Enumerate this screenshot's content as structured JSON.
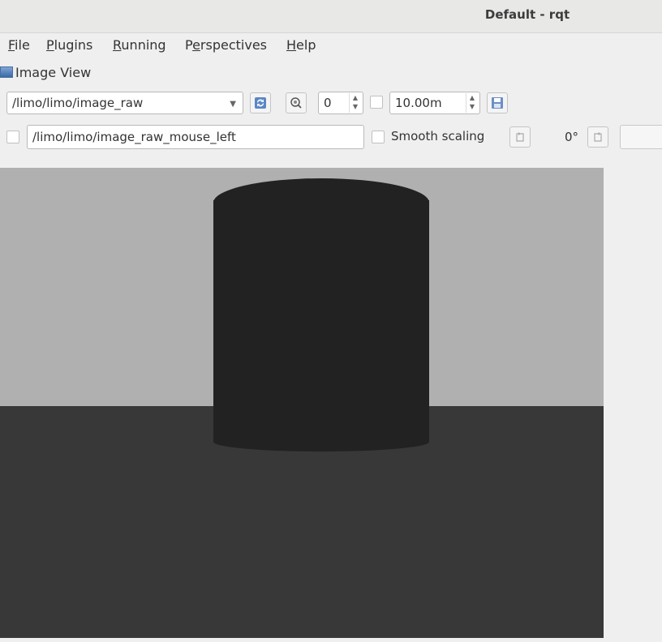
{
  "window": {
    "title": "Default - rqt"
  },
  "menu": [
    {
      "mnemonic": "F",
      "rest": "ile"
    },
    {
      "mnemonic": "P",
      "rest": "lugins"
    },
    {
      "mnemonic": "R",
      "rest": "unning"
    },
    {
      "pre": "P",
      "mnemonic": "e",
      "rest": "rspectives"
    },
    {
      "mnemonic": "H",
      "rest": "elp"
    }
  ],
  "plugin": {
    "title": "Image View",
    "icon": "image-view-icon"
  },
  "toolbar": {
    "topic_selected": "/limo/limo/image_raw",
    "refresh_icon": "refresh-icon",
    "zoom_icon": "zoom-icon",
    "zoom_value": "0",
    "dynamic_range_value": "10.00m",
    "save_icon": "save-icon"
  },
  "row2": {
    "mouse_topic": "/limo/limo/image_raw_mouse_left",
    "smooth_scaling_label": "Smooth scaling",
    "rotation_value": "0°",
    "rotate_left_icon": "rotate-left-icon",
    "rotate_right_icon": "rotate-right-icon"
  },
  "colors": {
    "sky": "#b0b0b0",
    "floor": "#383838",
    "object": "#222222"
  }
}
